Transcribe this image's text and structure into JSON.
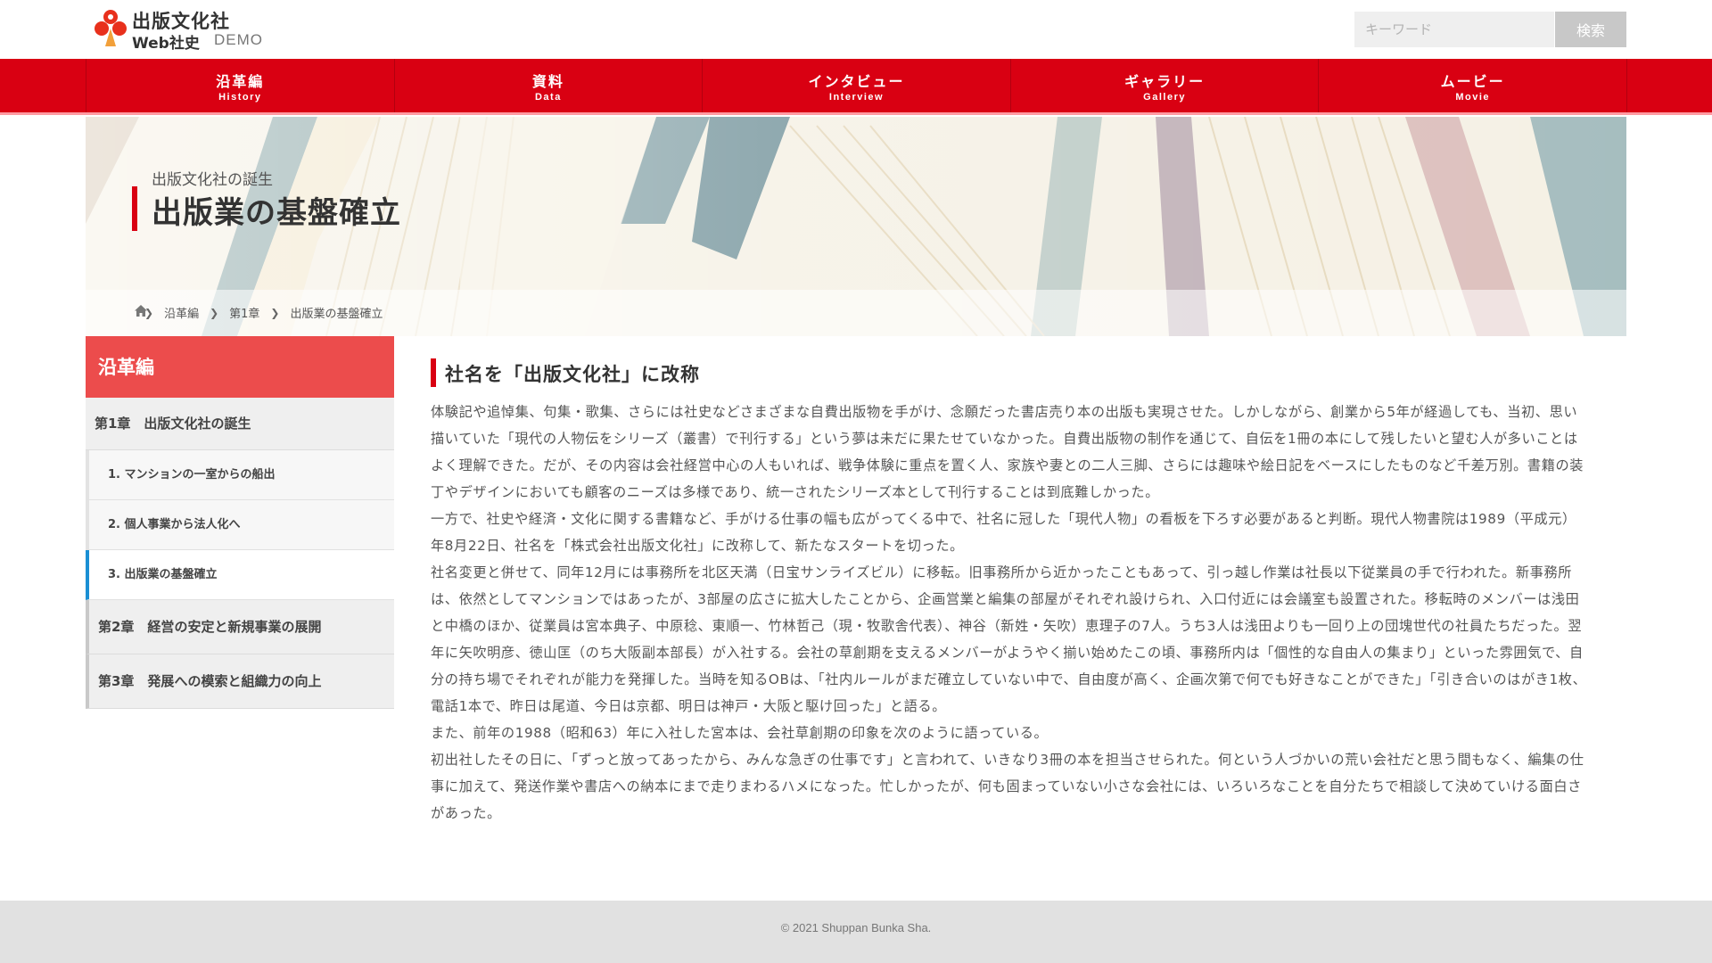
{
  "header": {
    "logo_name": "出版文化社",
    "logo_sub": "Web社史",
    "logo_demo": "DEMO",
    "search_placeholder": "キーワード",
    "search_button": "検索"
  },
  "nav": [
    {
      "ja": "沿革編",
      "en": "History"
    },
    {
      "ja": "資料",
      "en": "Data"
    },
    {
      "ja": "インタビュー",
      "en": "Interview"
    },
    {
      "ja": "ギャラリー",
      "en": "Gallery"
    },
    {
      "ja": "ムービー",
      "en": "Movie"
    }
  ],
  "hero": {
    "kicker": "出版文化社の誕生",
    "title": "出版業の基盤確立",
    "breadcrumb": [
      "沿革編",
      "第1章",
      "出版業の基盤確立"
    ]
  },
  "sidebar": {
    "heading": "沿革編",
    "chapter1": "第1章　出版文化社の誕生",
    "subs": [
      "1. マンションの一室からの船出",
      "2. 個人事業から法人化へ",
      "3. 出版業の基盤確立"
    ],
    "chapter2": "第2章　経営の安定と新規事業の展開",
    "chapter3": "第3章　発展への模索と組織力の向上"
  },
  "content": {
    "section_title": "社名を「出版文化社」に改称",
    "paragraphs": [
      "体験記や追悼集、句集・歌集、さらには社史などさまざまな自費出版物を手がけ、念願だった書店売り本の出版も実現させた。しかしながら、創業から5年が経過しても、当初、思い描いていた「現代の人物伝をシリーズ（叢書）で刊行する」という夢は未だに果たせていなかった。自費出版物の制作を通じて、自伝を1冊の本にして残したいと望む人が多いことはよく理解できた。だが、その内容は会社経営中心の人もいれば、戦争体験に重点を置く人、家族や妻との二人三脚、さらには趣味や絵日記をベースにしたものなど千差万別。書籍の装丁やデザインにおいても顧客のニーズは多様であり、統一されたシリーズ本として刊行することは到底難しかった。",
      "一方で、社史や経済・文化に関する書籍など、手がける仕事の幅も広がってくる中で、社名に冠した「現代人物」の看板を下ろす必要があると判断。現代人物書院は1989（平成元）年8月22日、社名を「株式会社出版文化社」に改称して、新たなスタートを切った。",
      "社名変更と併せて、同年12月には事務所を北区天満（日宝サンライズビル）に移転。旧事務所から近かったこともあって、引っ越し作業は社長以下従業員の手で行われた。新事務所は、依然としてマンションではあったが、3部屋の広さに拡大したことから、企画営業と編集の部屋がそれぞれ設けられ、入口付近には会議室も設置された。移転時のメンバーは浅田と中橋のほか、従業員は宮本典子、中原稔、東順一、竹林哲己（現・牧歌舎代表）、神谷（新姓・矢吹）恵理子の7人。うち3人は浅田よりも一回り上の団塊世代の社員たちだった。翌年に矢吹明彦、徳山匡（のち大阪副本部長）が入社する。会社の草創期を支えるメンバーがようやく揃い始めたこの頃、事務所内は「個性的な自由人の集まり」といった雰囲気で、自分の持ち場でそれぞれが能力を発揮した。当時を知るOBは、「社内ルールがまだ確立していない中で、自由度が高く、企画次第で何でも好きなことができた」「引き合いのはがき1枚、電話1本で、昨日は尾道、今日は京都、明日は神戸・大阪と駆け回った」と語る。",
      "また、前年の1988（昭和63）年に入社した宮本は、会社草創期の印象を次のように語っている。",
      "初出社したその日に、「ずっと放ってあったから、みんな急ぎの仕事です」と言われて、いきなり3冊の本を担当させられた。何という人づかいの荒い会社だと思う間もなく、編集の仕事に加えて、発送作業や書店への納本にまで走りまわるハメになった。忙しかったが、何も固まっていない小さな会社には、いろいろなことを自分たちで相談して決めていける面白さがあった。"
    ]
  },
  "footer": {
    "copyright": "© 2021 Shuppan Bunka Sha."
  },
  "colors": {
    "brand_red": "#d90012",
    "sidebar_head": "#ec4c4c",
    "active_marker": "#1a8fd4"
  }
}
